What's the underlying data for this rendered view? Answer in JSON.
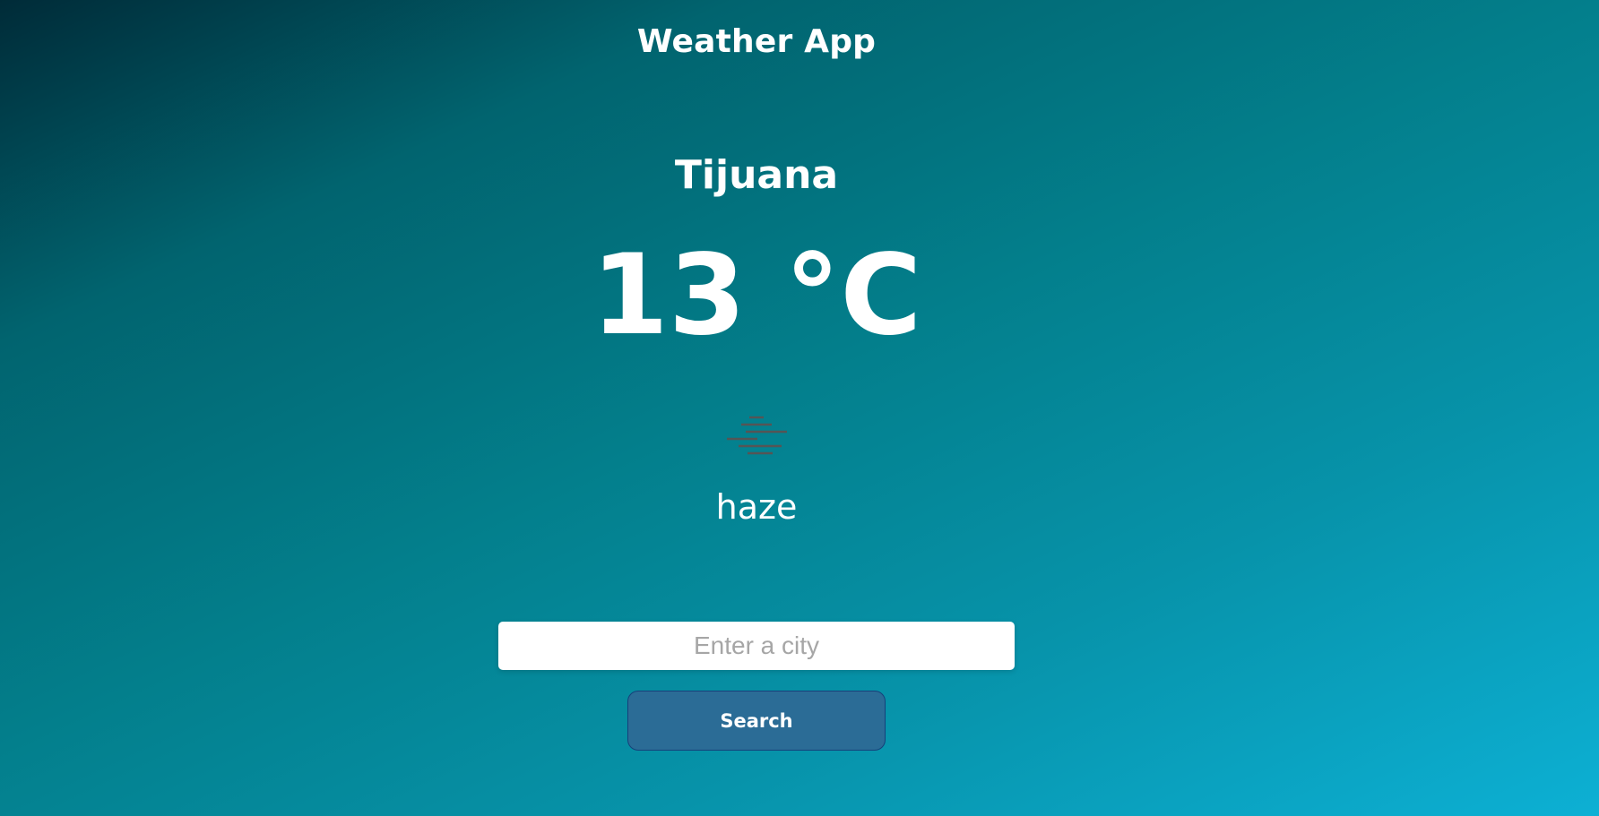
{
  "header": {
    "title": "Weather App"
  },
  "weather": {
    "city": "Tijuana",
    "temperature": "13 °C",
    "icon": "haze-icon",
    "description": "haze"
  },
  "search": {
    "placeholder": "Enter a city",
    "value": "",
    "button_label": "Search"
  },
  "colors": {
    "button_background": "#2b6c96",
    "gradient_start": "#002b38",
    "gradient_end": "#0db0d4"
  }
}
